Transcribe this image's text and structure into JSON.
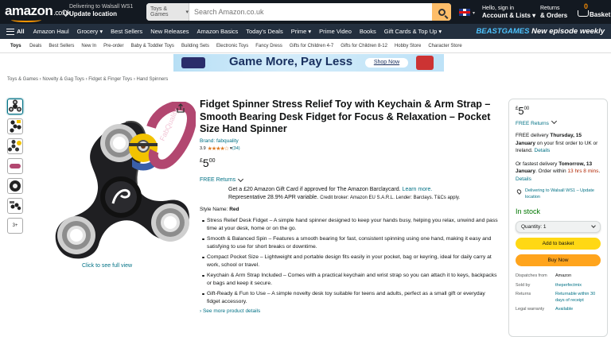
{
  "header": {
    "logo": "amazon",
    "logo_tld": ".co.uk",
    "deliver_line1": "Delivering to Walsall WS1",
    "deliver_line2": "Update location",
    "search_category": "Toys & Games",
    "search_placeholder": "Search Amazon.co.uk",
    "account_line1": "Hello, sign in",
    "account_line2": "Account & Lists",
    "returns_line1": "Returns",
    "returns_line2": "& Orders",
    "cart_count": "0",
    "cart_label": "Basket"
  },
  "nav": {
    "all": "All",
    "items": [
      "Amazon Haul",
      "Grocery",
      "Best Sellers",
      "New Releases",
      "Amazon Basics",
      "Today's Deals",
      "Prime",
      "Prime Video",
      "Books",
      "Gift Cards & Top Up"
    ],
    "promo_brand": "BEASTGAMES",
    "promo_text": "New episode weekly"
  },
  "subnav": {
    "first": "Toys",
    "items": [
      "Deals",
      "Best Sellers",
      "New In",
      "Pre-order",
      "Baby & Toddler Toys",
      "Building Sets",
      "Electronic Toys",
      "Fancy Dress",
      "Gifts for Children 4-7",
      "Gifts for Children 8-12",
      "Hobby Store",
      "Character Store"
    ]
  },
  "banner": {
    "text": "Game More, Pay Less",
    "button": "Shop Now"
  },
  "breadcrumb": "Toys & Games › Novelty & Gag Toys › Fidget & Finger Toys › Hand Spinners",
  "gallery": {
    "more": "3+",
    "see_full": "Click to see full view",
    "strap_text": "FabQuality"
  },
  "product": {
    "title": "Fidget Spinner Stress Relief Toy with Keychain & Arm Strap – Smooth Bearing Desk Fidget for Focus & Relaxation – Pocket Size Hand Spinner",
    "brand": "Brand: fabquality",
    "rating_value": "3.9",
    "rating_stars": "★★★★☆",
    "rating_count": "(34)",
    "price_currency": "£",
    "price_whole": "5",
    "price_fraction": "00",
    "free_returns": "FREE Returns",
    "cc_text1": "Get a £20 Amazon Gift Card if approved for The Amazon Barclaycard.",
    "cc_link": "Learn more.",
    "cc_text2": "Representative 28.9% APR variable.",
    "cc_small": "Credit broker: Amazon EU S.A.R.L. Lender: Barclays. T&Cs apply.",
    "style_label": "Style Name:",
    "style_value": "Red",
    "bullets": [
      "Stress Relief Desk Fidget – A simple hand spinner designed to keep your hands busy, helping you relax, unwind and pass time at your desk, home or on the go.",
      "Smooth & Balanced Spin – Features a smooth bearing for fast, consistent spinning using one hand, making it easy and satisfying to use for short breaks or downtime.",
      "Compact Pocket Size – Lightweight and portable design fits easily in your pocket, bag or keyring, ideal for daily carry at work, school or travel.",
      "Keychain & Arm Strap Included – Comes with a practical keychain and wrist strap so you can attach it to keys, backpacks or bags and keep it secure.",
      "Gift-Ready & Fun to Use – A simple novelty desk toy suitable for teens and adults, perfect as a small gift or everyday fidget accessory."
    ],
    "see_more": "› See more product details"
  },
  "buybox": {
    "price_currency": "£",
    "price_whole": "5",
    "price_fraction": "00",
    "free_returns": "FREE Returns",
    "delivery1_pre": "FREE delivery",
    "delivery1_date": "Thursday, 15 January",
    "delivery1_post": "on your first order to UK or Ireland.",
    "details": "Details",
    "delivery2_pre": "Or fastest delivery",
    "delivery2_date": "Tomorrow, 13 January",
    "delivery2_mid": ". Order within",
    "delivery2_time": "13 hrs 8 mins",
    "delivery2_post": ".",
    "location": "Delivering to Walsall WS1 – Update location",
    "stock": "In stock",
    "quantity": "Quantity: 1",
    "add_to_basket": "Add to basket",
    "buy_now": "Buy Now",
    "rows": [
      {
        "k": "Dispatches from",
        "v": "Amazon",
        "link": false
      },
      {
        "k": "Sold by",
        "v": "theperfectmix",
        "link": true
      },
      {
        "k": "Returns",
        "v": "Returnable within 30 days of receipt",
        "link": true
      },
      {
        "k": "Legal warranty",
        "v": "Available",
        "link": true
      }
    ]
  },
  "colors": {
    "topbar": "#131921",
    "navbar": "#232f3e",
    "accent_orange": "#ff9900",
    "link": "#007185",
    "in_stock": "#007600",
    "add_button": "#ffd814",
    "buy_button": "#ffa41c"
  }
}
